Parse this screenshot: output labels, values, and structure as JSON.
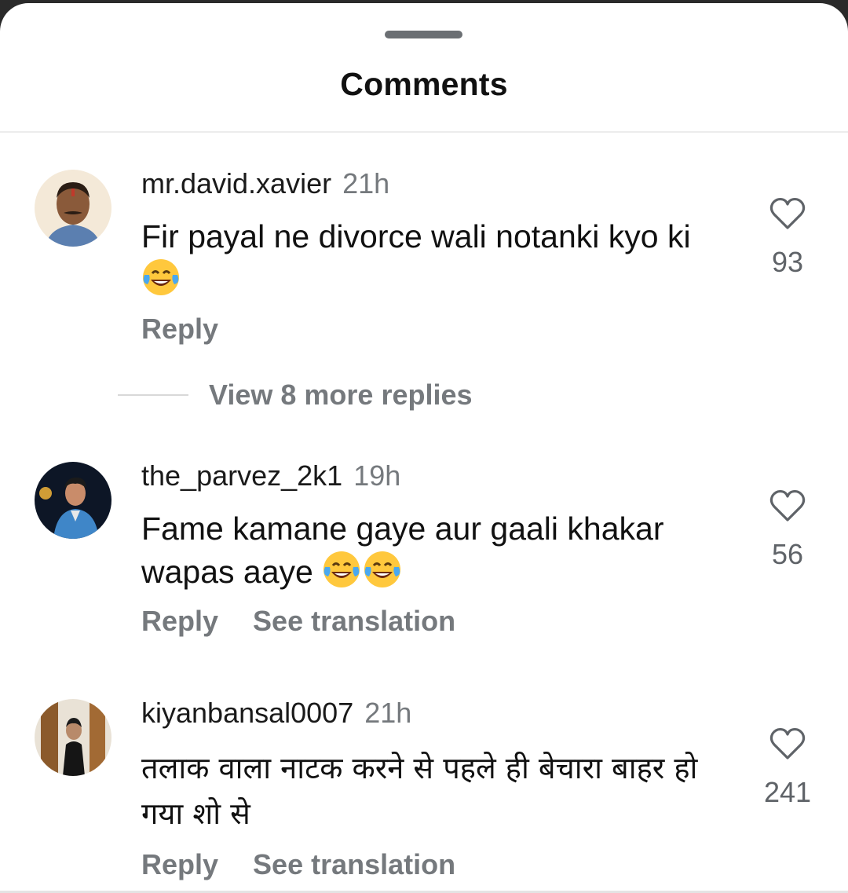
{
  "header": {
    "title": "Comments"
  },
  "comments": [
    {
      "username": "mr.david.xavier",
      "time": "21h",
      "text": "Fir payal ne divorce wali notanki kyo ki",
      "emojis": [
        "laughing-tears-emoji"
      ],
      "likes": "93",
      "reply_label": "Reply"
    },
    {
      "username": "the_parvez_2k1",
      "time": "19h",
      "text": "Fame kamane gaye aur gaali khakar wapas aaye",
      "emojis": [
        "laughing-tears-emoji",
        "laughing-tears-emoji"
      ],
      "likes": "56",
      "reply_label": "Reply",
      "translate_label": "See translation"
    },
    {
      "username": "kiyanbansal0007",
      "time": "21h",
      "text": "तलाक वाला नाटक करने से पहले ही बेचारा बाहर हो गया शो से",
      "likes": "241",
      "reply_label": "Reply",
      "translate_label": "See translation"
    }
  ],
  "view_replies": {
    "label": "View 8 more replies"
  },
  "icons": {
    "like": "heart-outline-icon"
  },
  "colors": {
    "sheet_background": "#ffffff",
    "secondary_text": "#75797d",
    "grabber": "#6b6f73",
    "emoji_face": "#ffc83d",
    "emoji_tear": "#4aa8f0"
  }
}
